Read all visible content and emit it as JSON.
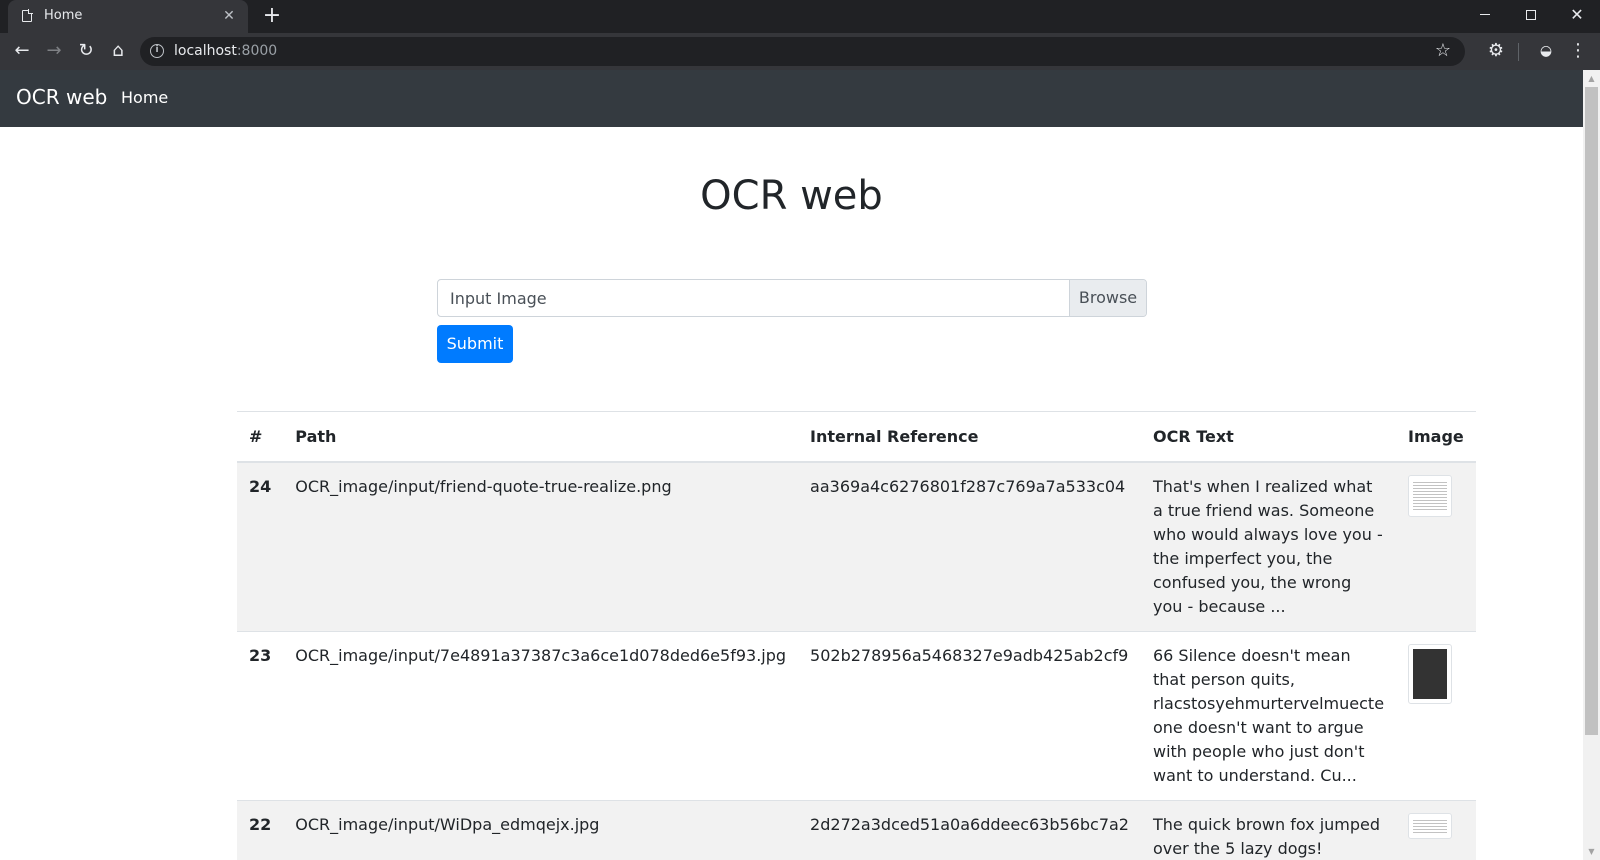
{
  "browser": {
    "tab_title": "Home",
    "url_host": "localhost",
    "url_port": ":8000"
  },
  "navbar": {
    "brand": "OCR web",
    "home_link": "Home"
  },
  "page": {
    "title": "OCR web",
    "file_input_label": "Input Image",
    "browse_label": "Browse",
    "submit_label": "Submit"
  },
  "table": {
    "headers": [
      "#",
      "Path",
      "Internal Reference",
      "OCR Text",
      "Image"
    ],
    "rows": [
      {
        "num": "24",
        "path": "OCR_image/input/friend-quote-true-realize.png",
        "ref": "aa369a4c6276801f287c769a7a533c04",
        "text": "That's when I realized what a true friend was. Someone who would always love you - the imperfect you, the confused you, the wrong you - because ..."
      },
      {
        "num": "23",
        "path": "OCR_image/input/7e4891a37387c3a6ce1d078ded6e5f93.jpg",
        "ref": "502b278956a5468327e9adb425ab2cf9",
        "text": "66 Silence doesn't mean that person quits, rlacstosyehmurtervelmuecte one doesn't want to argue with people who just don't want to understand. Cu..."
      },
      {
        "num": "22",
        "path": "OCR_image/input/WiDpa_edmqejx.jpg",
        "ref": "2d272a3dced51a0a6ddeec63b56bc7a2",
        "text": "The quick brown fox jumped over the 5 lazy dogs!"
      }
    ]
  },
  "colors": {
    "navbar_bg": "#343a40",
    "primary": "#007bff",
    "stripe": "#f2f2f2"
  }
}
